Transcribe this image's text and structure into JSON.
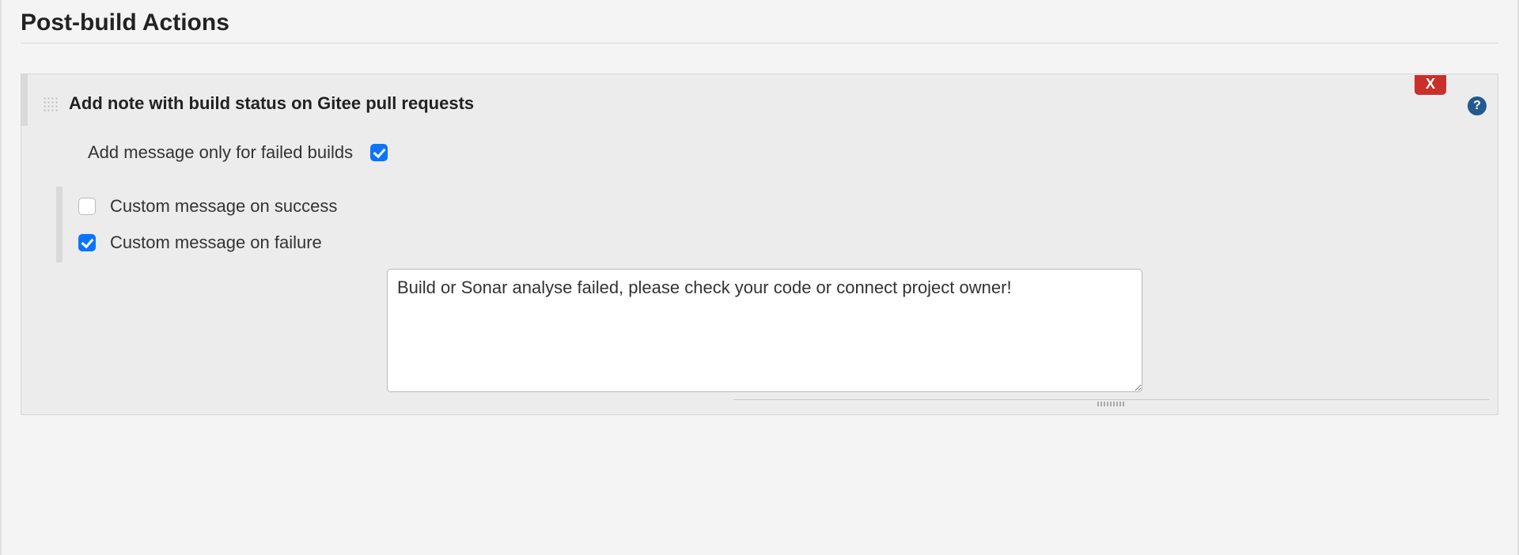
{
  "section": {
    "title": "Post-build Actions"
  },
  "action": {
    "title": "Add note with build status on Gitee pull requests",
    "delete_label": "X",
    "help_label": "?",
    "fields": {
      "only_failed": {
        "label": "Add message only for failed builds",
        "checked": true
      },
      "custom_success": {
        "label": "Custom message on success",
        "checked": false
      },
      "custom_failure": {
        "label": "Custom message on failure",
        "checked": true,
        "value": "Build or Sonar analyse failed, please check your code or connect project owner!"
      }
    }
  }
}
